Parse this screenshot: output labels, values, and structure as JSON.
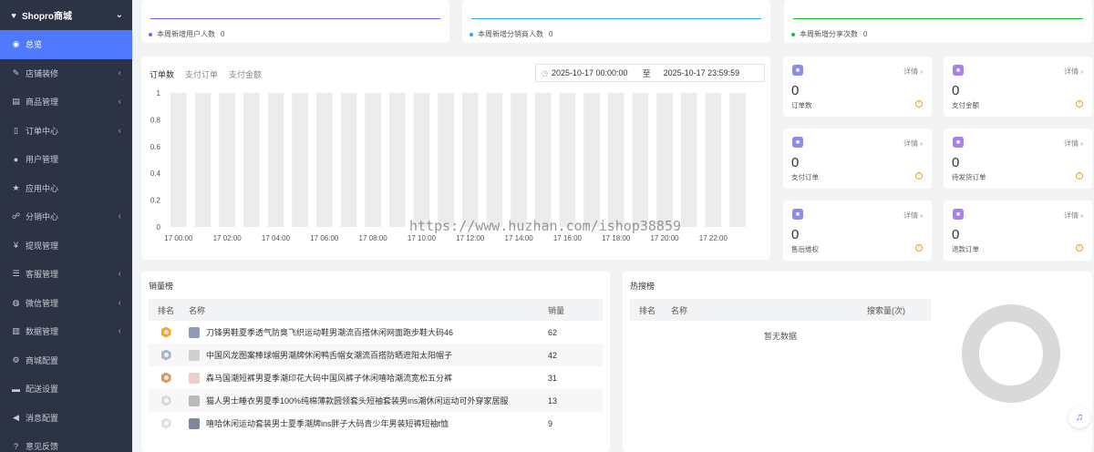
{
  "brand": {
    "title": "Shopro商城"
  },
  "sidebar": {
    "items": [
      {
        "label": "总览",
        "icon": "palette-icon",
        "glyph": "◉",
        "active": true,
        "arrow": false
      },
      {
        "label": "店铺装修",
        "icon": "brush-icon",
        "glyph": "✎",
        "arrow": true
      },
      {
        "label": "商品管理",
        "icon": "box-icon",
        "glyph": "▤",
        "arrow": true
      },
      {
        "label": "订单中心",
        "icon": "file-icon",
        "glyph": "▯",
        "arrow": true
      },
      {
        "label": "用户管理",
        "icon": "user-icon",
        "glyph": "●",
        "arrow": false
      },
      {
        "label": "应用中心",
        "icon": "star-icon",
        "glyph": "★",
        "arrow": false
      },
      {
        "label": "分销中心",
        "icon": "users-icon",
        "glyph": "☍",
        "arrow": true
      },
      {
        "label": "提现管理",
        "icon": "yen-icon",
        "glyph": "¥",
        "arrow": false
      },
      {
        "label": "客服管理",
        "icon": "list-icon",
        "glyph": "☰",
        "arrow": true
      },
      {
        "label": "微信管理",
        "icon": "wechat-icon",
        "glyph": "◍",
        "arrow": true
      },
      {
        "label": "数据管理",
        "icon": "bar-chart-icon",
        "glyph": "▥",
        "arrow": true
      },
      {
        "label": "商城配置",
        "icon": "gears-icon",
        "glyph": "⚙",
        "arrow": false
      },
      {
        "label": "配送设置",
        "icon": "car-icon",
        "glyph": "▬",
        "arrow": false
      },
      {
        "label": "消息配置",
        "icon": "bullhorn-icon",
        "glyph": "◀",
        "arrow": false
      },
      {
        "label": "意见反馈",
        "icon": "question-icon",
        "glyph": "?",
        "arrow": false
      }
    ]
  },
  "strips": [
    {
      "label": "本周新增用户人数",
      "value": "0",
      "color": "#7b61ff"
    },
    {
      "label": "本周新增分销商人数",
      "value": "0",
      "color": "#2aa7e8"
    },
    {
      "label": "本周新增分享次数",
      "value": "0",
      "color": "#16c02f"
    }
  ],
  "chart_panel": {
    "tabs": [
      "订单数",
      "支付订单",
      "支付金额"
    ],
    "date_start": "2025-10-17 00:00:00",
    "date_sep": "至",
    "date_end": "2025-10-17 23:59:59",
    "watermark": "https://www.huzhan.com/ishop38859"
  },
  "chart_data": {
    "type": "bar",
    "x": [
      "17 00:00",
      "17 01:00",
      "17 02:00",
      "17 03:00",
      "17 04:00",
      "17 05:00",
      "17 06:00",
      "17 07:00",
      "17 08:00",
      "17 09:00",
      "17 10:00",
      "17 11:00",
      "17 12:00",
      "17 13:00",
      "17 14:00",
      "17 15:00",
      "17 16:00",
      "17 17:00",
      "17 18:00",
      "17 19:00",
      "17 20:00",
      "17 21:00",
      "17 22:00",
      "17 23:00"
    ],
    "x_tick_labels": [
      "17 00:00",
      "17 02:00",
      "17 04:00",
      "17 06:00",
      "17 08:00",
      "17 10:00",
      "17 12:00",
      "17 14:00",
      "17 16:00",
      "17 18:00",
      "17 20:00",
      "17 22:00"
    ],
    "values": [
      0,
      0,
      0,
      0,
      0,
      0,
      0,
      0,
      0,
      0,
      0,
      0,
      0,
      0,
      0,
      0,
      0,
      0,
      0,
      0,
      0,
      0,
      0,
      0
    ],
    "background_bars": true,
    "y_ticks": [
      "1",
      "0.8",
      "0.6",
      "0.4",
      "0.2",
      "0"
    ],
    "ylim": [
      0,
      1
    ],
    "grid": false,
    "bar_bg_color": "#ececec"
  },
  "mini_cards": [
    {
      "label": "订单数",
      "value": "0",
      "detail": "详情",
      "icon": "order-icon",
      "color": "#8c8cf0"
    },
    {
      "label": "支付金额",
      "value": "0",
      "detail": "详情",
      "icon": "wallet-icon",
      "color": "#a680f0"
    },
    {
      "label": "支付订单",
      "value": "0",
      "detail": "详情",
      "icon": "paid-order-icon",
      "color": "#8c8cf0"
    },
    {
      "label": "待发货订单",
      "value": "0",
      "detail": "详情",
      "icon": "shipping-icon",
      "color": "#a680f0"
    },
    {
      "label": "售后维权",
      "value": "0",
      "detail": "详情",
      "icon": "shield-icon",
      "color": "#8c8cf0"
    },
    {
      "label": "退款订单",
      "value": "0",
      "detail": "详情",
      "icon": "refund-icon",
      "color": "#a680f0"
    }
  ],
  "sales_rank": {
    "title": "销量榜",
    "headers": {
      "rank": "排名",
      "name": "名称",
      "sales": "销量"
    },
    "rows": [
      {
        "name": "刀锋男鞋夏季透气防臭飞织运动鞋男潮流百搭休闲网面跑步鞋大码46",
        "sales": "62",
        "medal": "#f5a623",
        "thumb": "#8f99b8"
      },
      {
        "name": "中国风龙图案棒球帽男潮牌休闲鸭舌帽女潮流百搭防晒遮阳太阳帽子",
        "sales": "42",
        "medal": "#a9b6c8",
        "thumb": "#cfcfcf"
      },
      {
        "name": "森马国潮短裤男夏季潮印花大码中国风裤子休闲嘻哈潮流宽松五分裤",
        "sales": "31",
        "medal": "#e0965a",
        "thumb": "#e8cfc7"
      },
      {
        "name": "猫人男士睡衣男夏季100%纯棉薄款圆领套头短袖套装男ins潮休闲运动可外穿家居服",
        "sales": "13",
        "medal": "#d8d8d8",
        "thumb": "#b9b9b9"
      },
      {
        "name": "嘻哈休闲运动套装男士夏季潮牌ins胖子大码青少年男装短裤短袖t恤",
        "sales": "9",
        "medal": "#e0e0e0",
        "thumb": "#7f8799"
      }
    ]
  },
  "hot_search": {
    "title": "热搜榜",
    "headers": {
      "rank": "排名",
      "name": "名称",
      "count": "搜索量(次)"
    },
    "empty": "暂无数据"
  }
}
